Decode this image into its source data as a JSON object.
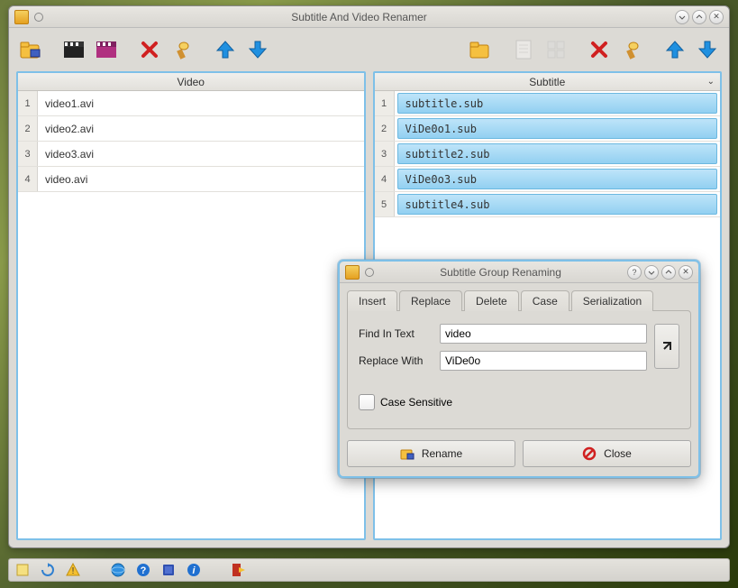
{
  "main": {
    "title": "Subtitle And Video Renamer"
  },
  "video_panel": {
    "header": "Video",
    "files": [
      "video1.avi",
      "video2.avi",
      "video3.avi",
      "video.avi"
    ]
  },
  "subtitle_panel": {
    "header": "Subtitle",
    "files": [
      "subtitle.sub",
      "ViDe0o1.sub",
      "subtitle2.sub",
      "ViDe0o3.sub",
      "subtitle4.sub"
    ]
  },
  "dialog": {
    "title": "Subtitle Group Renaming",
    "tabs": {
      "insert": "Insert",
      "replace": "Replace",
      "delete": "Delete",
      "case": "Case",
      "serialization": "Serialization"
    },
    "find_label": "Find In Text",
    "find_value": "video",
    "replace_label": "Replace With",
    "replace_value": "ViDe0o",
    "case_sensitive": "Case Sensitive",
    "rename_btn": "Rename",
    "close_btn": "Close"
  }
}
